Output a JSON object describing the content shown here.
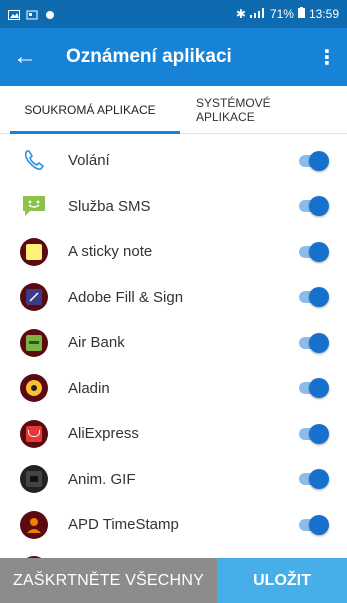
{
  "status_bar": {
    "battery": "71%",
    "time": "13:59"
  },
  "app_bar": {
    "back_glyph": "←",
    "title": "Oznámení aplikaci",
    "more_glyph": "⋮"
  },
  "tabs": [
    {
      "label": "SOUKROMÁ APLIKACE",
      "active": true
    },
    {
      "label": "SYSTÉMOVÉ APLIKACE",
      "active": false
    }
  ],
  "apps": [
    {
      "name": "Volání",
      "icon": "phone-icon",
      "enabled": true
    },
    {
      "name": "Služba SMS",
      "icon": "sms-icon",
      "enabled": true
    },
    {
      "name": "A sticky note",
      "icon": "sticky-note-icon",
      "enabled": true
    },
    {
      "name": "Adobe Fill & Sign",
      "icon": "adobe-fill-sign-icon",
      "enabled": true
    },
    {
      "name": "Air Bank",
      "icon": "air-bank-icon",
      "enabled": true
    },
    {
      "name": "Aladin",
      "icon": "aladin-icon",
      "enabled": true
    },
    {
      "name": "AliExpress",
      "icon": "aliexpress-icon",
      "enabled": true
    },
    {
      "name": "Anim. GIF",
      "icon": "anim-gif-icon",
      "enabled": true
    },
    {
      "name": "APD TimeStamp",
      "icon": "apd-timestamp-icon",
      "enabled": true
    }
  ],
  "bottom": {
    "select_all_label": "ZAŠKRTNĚTE VŠECHNY",
    "save_label": "ULOŽIT"
  },
  "colors": {
    "status_bar": "#0f6bb0",
    "app_bar": "#1783d6",
    "toggle_on": "#1770cc",
    "save_button": "#46aee8"
  }
}
